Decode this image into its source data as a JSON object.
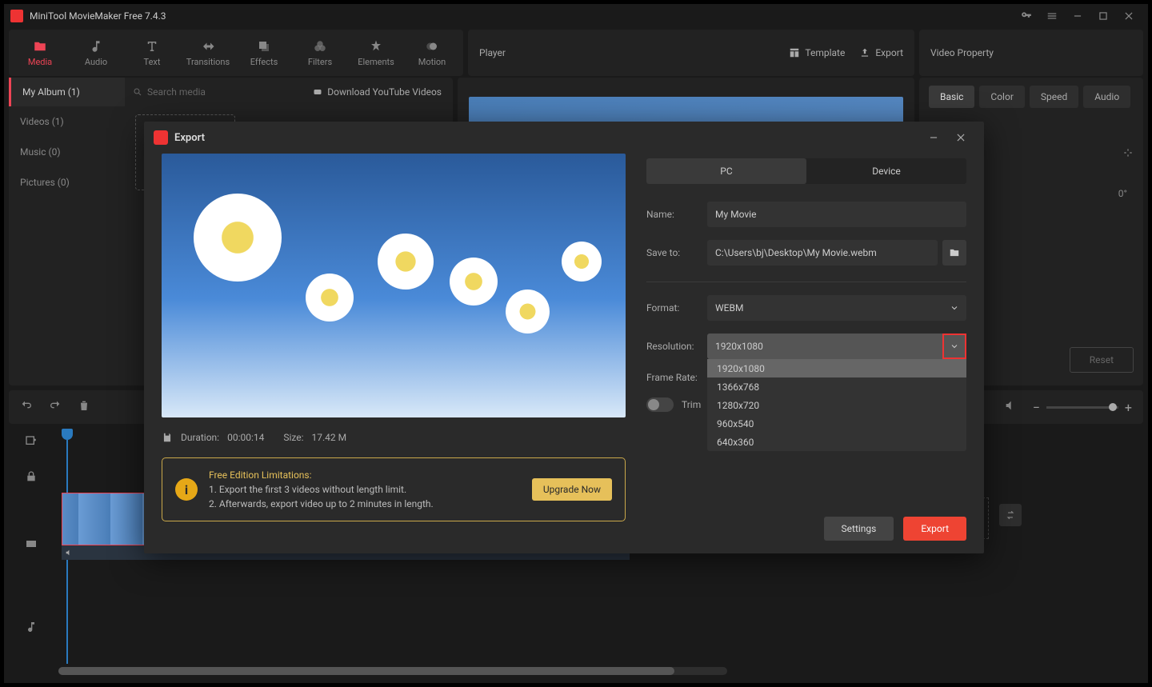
{
  "titlebar": {
    "title": "MiniTool MovieMaker Free 7.4.3"
  },
  "toolbar": {
    "items": [
      "Media",
      "Audio",
      "Text",
      "Transitions",
      "Effects",
      "Filters",
      "Elements",
      "Motion"
    ],
    "active": 0
  },
  "player": {
    "label": "Player",
    "template_btn": "Template",
    "export_btn": "Export"
  },
  "video_property": {
    "label": "Video Property",
    "tabs": [
      "Basic",
      "Color",
      "Speed",
      "Audio"
    ],
    "degrees": "0°",
    "reset": "Reset"
  },
  "media_panel": {
    "album": "My Album (1)",
    "search_placeholder": "Search media",
    "yt_link": "Download YouTube Videos",
    "side": [
      "Videos (1)",
      "Music (0)",
      "Pictures (0)"
    ]
  },
  "export_modal": {
    "title": "Export",
    "tabs": {
      "pc": "PC",
      "device": "Device"
    },
    "fields": {
      "name_label": "Name:",
      "name_value": "My Movie",
      "save_label": "Save to:",
      "save_value": "C:\\Users\\bj\\Desktop\\My Movie.webm",
      "format_label": "Format:",
      "format_value": "WEBM",
      "resolution_label": "Resolution:",
      "resolution_value": "1920x1080",
      "resolution_options": [
        "1920x1080",
        "1366x768",
        "1280x720",
        "960x540",
        "640x360"
      ],
      "framerate_label": "Frame Rate:",
      "trim_label": "Trim"
    },
    "info": {
      "duration_label": "Duration:",
      "duration_value": "00:00:14",
      "size_label": "Size:",
      "size_value": "17.42 M"
    },
    "limitations": {
      "heading": "Free Edition Limitations:",
      "line1": "1. Export the first 3 videos without length limit.",
      "line2": "2. Afterwards, export video up to 2 minutes in length.",
      "upgrade": "Upgrade Now"
    },
    "buttons": {
      "settings": "Settings",
      "export": "Export"
    }
  }
}
